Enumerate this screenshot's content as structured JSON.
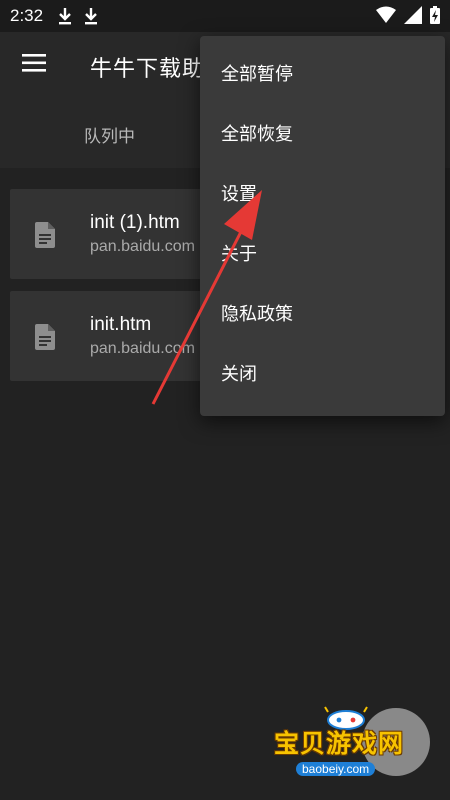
{
  "status": {
    "time": "2:32"
  },
  "appbar": {
    "title": "牛牛下载助手"
  },
  "tabs": [
    {
      "label": "队列中"
    }
  ],
  "downloads": [
    {
      "name": "init (1).htm",
      "source": "pan.baidu.com"
    },
    {
      "name": "init.htm",
      "source": "pan.baidu.com"
    }
  ],
  "menu": {
    "items": [
      {
        "label": "全部暂停"
      },
      {
        "label": "全部恢复"
      },
      {
        "label": "设置"
      },
      {
        "label": "关于"
      },
      {
        "label": "隐私政策"
      },
      {
        "label": "关闭"
      }
    ]
  },
  "watermark": {
    "text": "宝贝游戏网",
    "url": "baobeiy.com"
  },
  "colors": {
    "arrow": "#e53935",
    "surface": "#333333",
    "menu": "#3a3a3a",
    "background": "#222222"
  }
}
